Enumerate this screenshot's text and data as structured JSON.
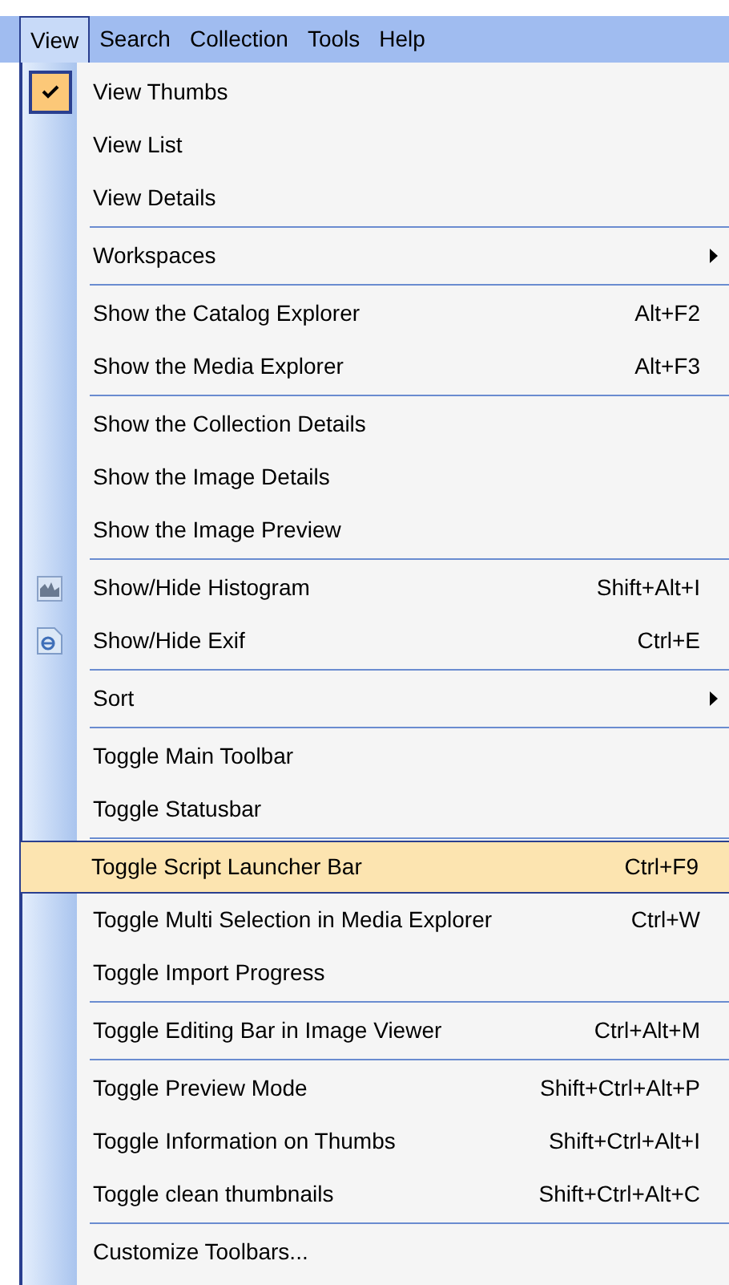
{
  "menu_bar": [
    {
      "label": "View",
      "selected": true
    },
    {
      "label": "Search",
      "selected": false
    },
    {
      "label": "Collection",
      "selected": false
    },
    {
      "label": "Tools",
      "selected": false
    },
    {
      "label": "Help",
      "selected": false
    }
  ],
  "menu": {
    "items": [
      {
        "kind": "item",
        "label": "View Thumbs",
        "checked": true,
        "selected": false
      },
      {
        "kind": "item",
        "label": "View List",
        "checked": false,
        "selected": false
      },
      {
        "kind": "item",
        "label": "View Details",
        "checked": false,
        "selected": false
      },
      {
        "kind": "separator"
      },
      {
        "kind": "submenu",
        "label": "Workspaces",
        "checked": false,
        "selected": false
      },
      {
        "kind": "separator"
      },
      {
        "kind": "item",
        "label": "Show the Catalog Explorer",
        "shortcut": "Alt+F2",
        "checked": false,
        "selected": false
      },
      {
        "kind": "item",
        "label": "Show the Media Explorer",
        "shortcut": "Alt+F3",
        "checked": false,
        "selected": false
      },
      {
        "kind": "separator"
      },
      {
        "kind": "item",
        "label": "Show the Collection Details",
        "checked": false,
        "selected": false
      },
      {
        "kind": "item",
        "label": "Show the Image Details",
        "checked": false,
        "selected": false
      },
      {
        "kind": "item",
        "label": "Show the Image Preview",
        "checked": false,
        "selected": false
      },
      {
        "kind": "separator"
      },
      {
        "kind": "icon-item",
        "label": "Show/Hide Histogram",
        "shortcut": "Shift+Alt+I",
        "checked": false,
        "selected": false
      },
      {
        "kind": "icon-item",
        "label": "Show/Hide Exif",
        "shortcut": "Ctrl+E",
        "checked": false,
        "selected": false
      },
      {
        "kind": "separator"
      },
      {
        "kind": "submenu",
        "label": "Sort",
        "checked": false,
        "selected": false
      },
      {
        "kind": "separator"
      },
      {
        "kind": "item",
        "label": "Toggle Main Toolbar",
        "checked": false,
        "selected": false
      },
      {
        "kind": "item",
        "label": "Toggle Statusbar",
        "checked": false,
        "selected": false
      },
      {
        "kind": "separator"
      },
      {
        "kind": "item",
        "label": "Toggle Script Launcher Bar",
        "shortcut": "Ctrl+F9",
        "checked": false,
        "selected": true
      },
      {
        "kind": "item",
        "label": "Toggle Multi Selection in Media Explorer",
        "shortcut": "Ctrl+W",
        "checked": false,
        "selected": false
      },
      {
        "kind": "item",
        "label": "Toggle Import Progress",
        "checked": false,
        "selected": false
      },
      {
        "kind": "separator"
      },
      {
        "kind": "item",
        "label": "Toggle Editing Bar in Image Viewer",
        "shortcut": "Ctrl+Alt+M",
        "checked": false,
        "selected": false
      },
      {
        "kind": "separator"
      },
      {
        "kind": "item",
        "label": "Toggle Preview Mode",
        "shortcut": "Shift+Ctrl+Alt+P",
        "checked": false,
        "selected": false
      },
      {
        "kind": "item",
        "label": "Toggle Information on Thumbs",
        "shortcut": "Shift+Ctrl+Alt+I",
        "checked": false,
        "selected": false
      },
      {
        "kind": "item",
        "label": "Toggle clean thumbnails",
        "shortcut": "Shift+Ctrl+Alt+C",
        "checked": false,
        "selected": false
      },
      {
        "kind": "separator"
      },
      {
        "kind": "item",
        "label": "Customize Toolbars...",
        "checked": false,
        "selected": false
      }
    ]
  }
}
